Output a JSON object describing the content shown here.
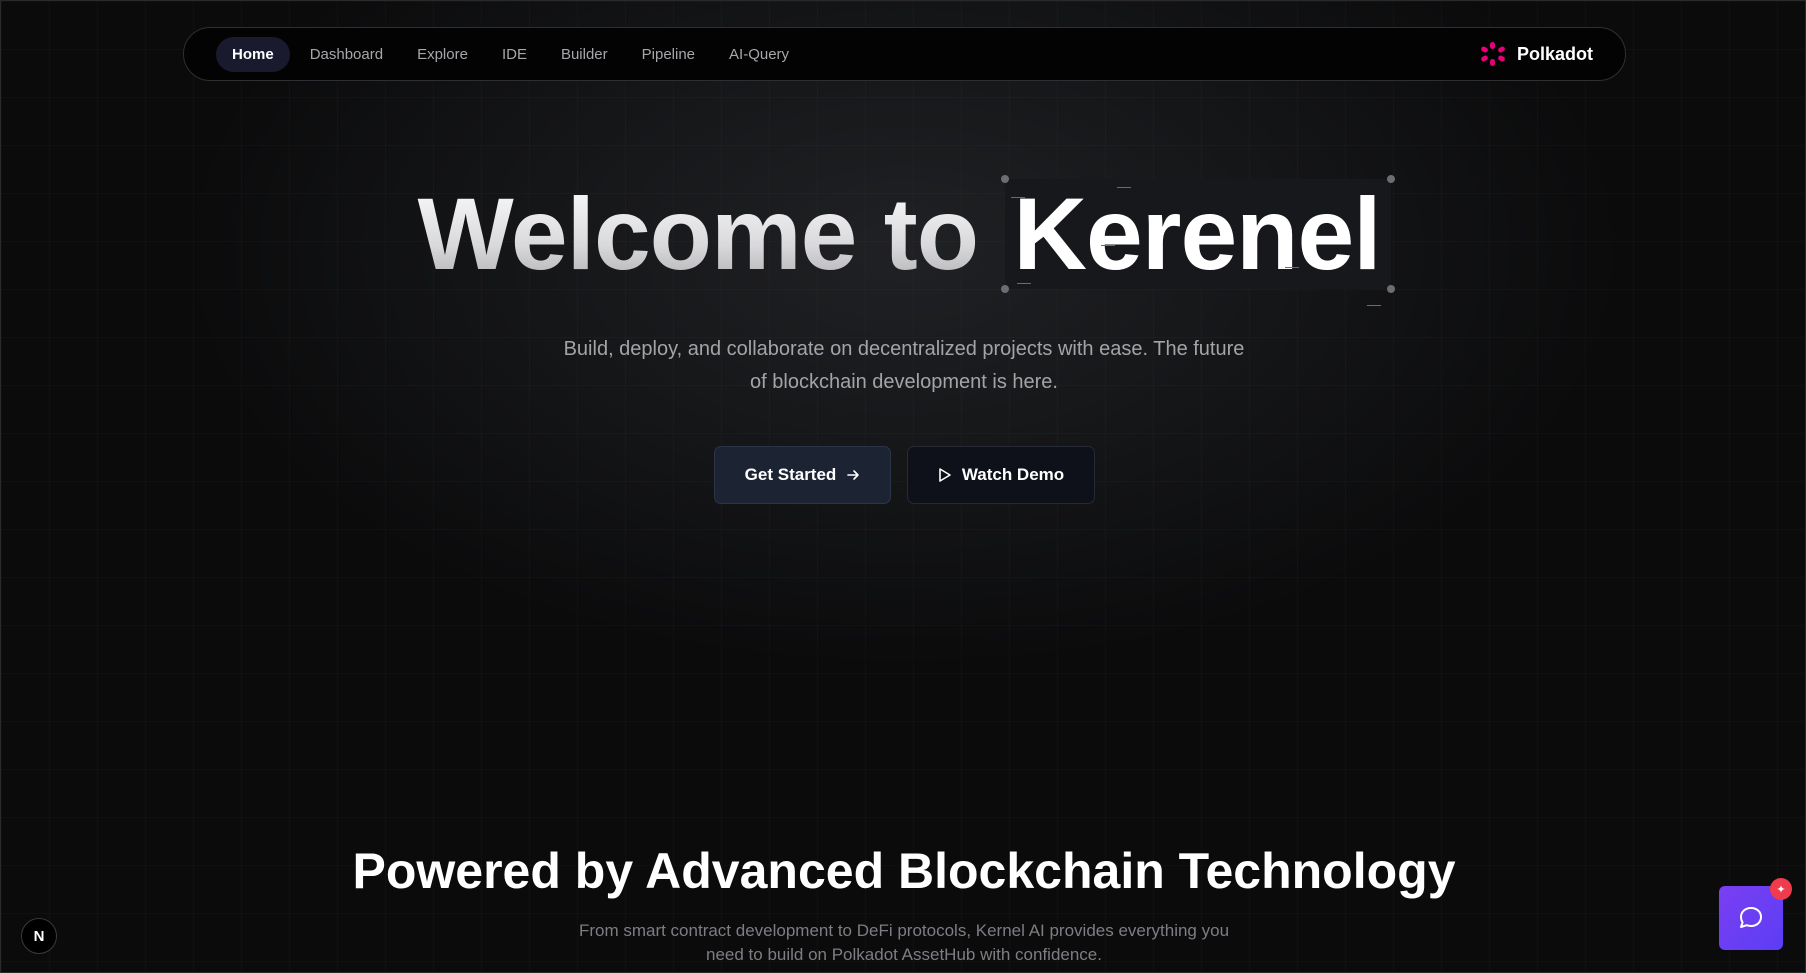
{
  "nav": {
    "items": [
      {
        "label": "Home",
        "active": true
      },
      {
        "label": "Dashboard"
      },
      {
        "label": "Explore"
      },
      {
        "label": "IDE"
      },
      {
        "label": "Builder"
      },
      {
        "label": "Pipeline"
      },
      {
        "label": "AI-Query"
      }
    ],
    "brand": "Polkadot",
    "brand_icon": "polkadot-logo-icon",
    "brand_color": "#e6007a"
  },
  "hero": {
    "title_prefix": "Welcome to",
    "title_highlight": "Kerenel",
    "subtitle": "Build, deploy, and collaborate on decentralized projects with ease. The future of blockchain development is here.",
    "primary_button": "Get Started",
    "primary_icon": "arrow-right-icon",
    "secondary_button": "Watch Demo",
    "secondary_icon": "play-icon"
  },
  "section": {
    "title": "Powered by Advanced Blockchain Technology",
    "description": "From smart contract development to DeFi protocols, Kernel AI provides everything you need to build on Polkadot AssetHub with confidence."
  },
  "floating": {
    "n_badge": "N",
    "chat_icon": "chat-bubble-icon",
    "chat_accent": "#6a3ef4",
    "notification_icon": "sparkle-icon"
  }
}
